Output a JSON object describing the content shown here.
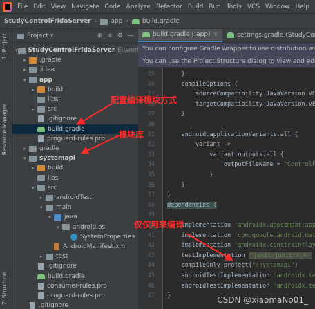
{
  "menubar": {
    "items": [
      "File",
      "Edit",
      "View",
      "Navigate",
      "Code",
      "Analyze",
      "Refactor",
      "Build",
      "Run",
      "Tools",
      "VCS",
      "Window",
      "Help"
    ]
  },
  "navbar": {
    "crumbs": [
      "StudyControlFridaServer",
      "app",
      "build.gradle"
    ]
  },
  "side_tabs": {
    "project": "1: Project",
    "resource_manager": "Resource Manager",
    "structure": "7: Structure"
  },
  "project_panel": {
    "title": "Project",
    "tree": [
      {
        "label": "StudyControlFridaServer",
        "extra": "E:\\worksp",
        "depth": 0,
        "arrow": "▾",
        "icon": "folder",
        "bold": true
      },
      {
        "label": ".gradle",
        "depth": 1,
        "arrow": "▸",
        "icon": "orange"
      },
      {
        "label": ".idea",
        "depth": 1,
        "arrow": "▸",
        "icon": "folder"
      },
      {
        "label": "app",
        "depth": 1,
        "arrow": "▾",
        "icon": "folder",
        "bold": true
      },
      {
        "label": "build",
        "depth": 2,
        "arrow": "▸",
        "icon": "orange"
      },
      {
        "label": "libs",
        "depth": 2,
        "arrow": "",
        "icon": "folder"
      },
      {
        "label": "src",
        "depth": 2,
        "arrow": "▸",
        "icon": "folder"
      },
      {
        "label": ".gitignore",
        "depth": 2,
        "arrow": "",
        "icon": "file"
      },
      {
        "label": "build.gradle",
        "depth": 2,
        "arrow": "",
        "icon": "gradle",
        "selected": true
      },
      {
        "label": "proguard-rules.pro",
        "depth": 2,
        "arrow": "",
        "icon": "file"
      },
      {
        "label": "gradle",
        "depth": 1,
        "arrow": "▸",
        "icon": "folder"
      },
      {
        "label": "systemapi",
        "depth": 1,
        "arrow": "▾",
        "icon": "folder",
        "bold": true
      },
      {
        "label": "build",
        "depth": 2,
        "arrow": "▸",
        "icon": "orange"
      },
      {
        "label": "libs",
        "depth": 2,
        "arrow": "",
        "icon": "folder"
      },
      {
        "label": "src",
        "depth": 2,
        "arrow": "▾",
        "icon": "folder"
      },
      {
        "label": "androidTest",
        "depth": 3,
        "arrow": "▸",
        "icon": "folder"
      },
      {
        "label": "main",
        "depth": 3,
        "arrow": "▾",
        "icon": "folder"
      },
      {
        "label": "java",
        "depth": 4,
        "arrow": "▾",
        "icon": "blue"
      },
      {
        "label": "android.os",
        "depth": 5,
        "arrow": "▾",
        "icon": "folder"
      },
      {
        "label": "SystemProperties",
        "depth": 6,
        "arrow": "",
        "icon": "class"
      },
      {
        "label": "AndroidManifest.xml",
        "depth": 4,
        "arrow": "",
        "icon": "xml"
      },
      {
        "label": "test",
        "depth": 3,
        "arrow": "▸",
        "icon": "folder"
      },
      {
        "label": ".gitignore",
        "depth": 2,
        "arrow": "",
        "icon": "file"
      },
      {
        "label": "build.gradle",
        "depth": 2,
        "arrow": "",
        "icon": "gradle"
      },
      {
        "label": "consumer-rules.pro",
        "depth": 2,
        "arrow": "",
        "icon": "file"
      },
      {
        "label": "proguard-rules.pro",
        "depth": 2,
        "arrow": "",
        "icon": "file"
      },
      {
        "label": ".gitignore",
        "depth": 1,
        "arrow": "",
        "icon": "file"
      }
    ]
  },
  "editor_tabs": [
    {
      "label": "build.gradle (:app)",
      "active": true
    },
    {
      "label": "settings.gradle (StudyControlF",
      "active": false
    }
  ],
  "banners": [
    "You can configure Gradle wrapper to use distribution with so",
    "You can use the Project Structure dialog to view and edit you"
  ],
  "code_lines": [
    {
      "n": "25",
      "text": "    }"
    },
    {
      "n": "26",
      "text": "    compileOptions {"
    },
    {
      "n": "27",
      "text": "        sourceCompatibility JavaVersion.VER"
    },
    {
      "n": "28",
      "text": "        targetCompatibility JavaVersion.VER"
    },
    {
      "n": "29",
      "text": "    }"
    },
    {
      "n": "30",
      "text": ""
    },
    {
      "n": "31",
      "text": "    android.applicationVariants.all {"
    },
    {
      "n": "32",
      "text": "        variant ->"
    },
    {
      "n": "33",
      "text": "            variant.outputs.all {"
    },
    {
      "n": "34",
      "text": "                outputFileName = \"ControlFr"
    },
    {
      "n": "35",
      "text": "            }"
    },
    {
      "n": "36",
      "text": "    }"
    },
    {
      "n": "37",
      "text": "}"
    },
    {
      "n": "38",
      "text": "dependencies {"
    },
    {
      "n": "39",
      "text": ""
    },
    {
      "n": "40",
      "text": "    implementation 'androidx.appcompat:appc"
    },
    {
      "n": "41",
      "text": "    implementation 'com.google.android.mate"
    },
    {
      "n": "42",
      "text": "    implementation 'androidx.constraintlayo"
    },
    {
      "n": "43",
      "text": "    testImplementation 'junit:junit:4.+'"
    },
    {
      "n": "44",
      "text": "    compileOnly project(\":systemapi\")"
    },
    {
      "n": "45",
      "text": "    androidTestImplementation 'androidx.tes"
    },
    {
      "n": "46",
      "text": "    androidTestImplementation 'androidx.tes"
    },
    {
      "n": "47",
      "text": "}"
    }
  ],
  "annotations": {
    "config_module": "配置编译模块方式",
    "module_lib": "模块库",
    "compile_only": "仅仅用来编译"
  },
  "watermark": "CSDN @xiaomaNo01_",
  "colors": {
    "annotation": "#ff2a2a",
    "selection": "#0d293e"
  }
}
